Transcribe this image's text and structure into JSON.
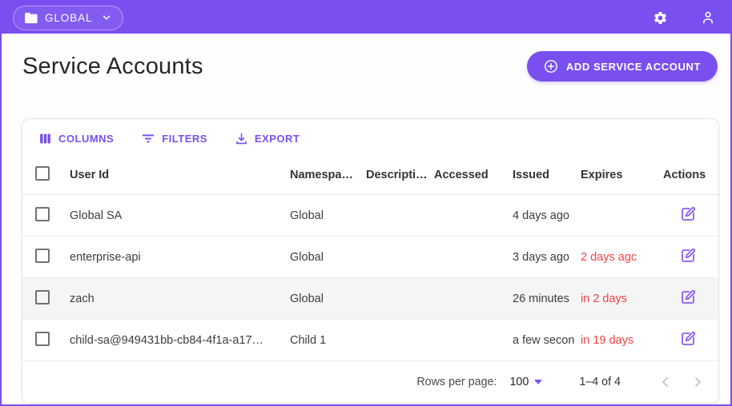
{
  "colors": {
    "primary": "#7A4FF0",
    "icon_purple": "#8B5CF6",
    "danger": "#EF4444",
    "topbar_bg": "#7A4FF0"
  },
  "topbar": {
    "org_selector_label": "GLOBAL"
  },
  "header": {
    "title": "Service Accounts",
    "add_button_label": "ADD SERVICE ACCOUNT"
  },
  "toolbar": {
    "columns_label": "COLUMNS",
    "filters_label": "FILTERS",
    "export_label": "EXPORT"
  },
  "table": {
    "headers": {
      "user_id": "User Id",
      "namespace": "Namespa…",
      "description": "Descripti…",
      "accessed": "Accessed",
      "issued": "Issued",
      "expires": "Expires",
      "actions": "Actions"
    },
    "rows": [
      {
        "user_id": "Global SA",
        "namespace": "Global",
        "description": "",
        "accessed": "",
        "issued": "4 days ago",
        "expires": ""
      },
      {
        "user_id": "enterprise-api",
        "namespace": "Global",
        "description": "",
        "accessed": "",
        "issued": "3 days ago",
        "expires": "2 days agc"
      },
      {
        "user_id": "zach",
        "namespace": "Global",
        "description": "",
        "accessed": "",
        "issued": "26 minutes",
        "expires": "in 2 days"
      },
      {
        "user_id": "child-sa@949431bb-cb84-4f1a-a17…",
        "namespace": "Child 1",
        "description": "",
        "accessed": "",
        "issued": "a few secon",
        "expires": "in 19 days"
      }
    ]
  },
  "pagination": {
    "rows_per_page_label": "Rows per page:",
    "rows_per_page_value": "100",
    "range_label": "1–4 of 4"
  }
}
